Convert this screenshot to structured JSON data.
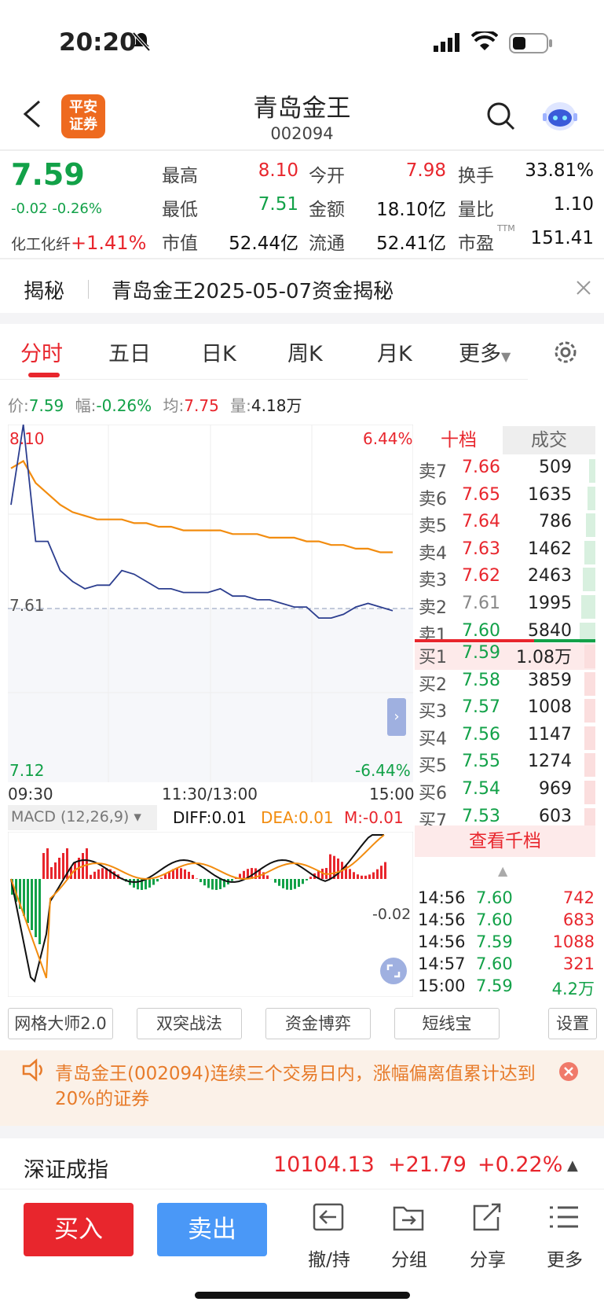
{
  "status": {
    "time": "20:20"
  },
  "header": {
    "back_icon": "chevron-left-icon",
    "logo_line1": "平安",
    "logo_line2": "证券",
    "title": "青岛金王",
    "code": "002094",
    "search_icon": "search-icon",
    "assistant_icon": "robot-icon"
  },
  "quote": {
    "price": "7.59",
    "change": "-0.02",
    "change_pct": "-0.26%",
    "sector_name": "化工化纤",
    "sector_pct": "+1.41%",
    "rows": [
      [
        {
          "label": "最高",
          "value": "8.10",
          "color": "red"
        },
        {
          "label": "今开",
          "value": "7.98",
          "color": "red"
        },
        {
          "label": "换手",
          "value": "33.81%",
          "color": "dark"
        }
      ],
      [
        {
          "label": "最低",
          "value": "7.51",
          "color": "green"
        },
        {
          "label": "金额",
          "value": "18.10亿",
          "color": "dark"
        },
        {
          "label": "量比",
          "value": "1.10",
          "color": "dark"
        }
      ],
      [
        {
          "label": "市值",
          "value": "52.44亿",
          "color": "dark"
        },
        {
          "label": "流通",
          "value": "52.41亿",
          "color": "dark"
        },
        {
          "label": "市盈",
          "value": "151.41",
          "color": "dark",
          "sup": "TTM"
        }
      ]
    ]
  },
  "reveal": {
    "tag": "揭秘",
    "text": "青岛金王2025-05-07资金揭秘"
  },
  "tabs": [
    "分时",
    "五日",
    "日K",
    "周K",
    "月K",
    "更多"
  ],
  "info": {
    "price_label": "价:",
    "price": "7.59",
    "amp_label": "幅:",
    "amp": "-0.26%",
    "avg_label": "均:",
    "avg": "7.75",
    "vol_label": "量:",
    "vol": "4.18万"
  },
  "chart_labels": {
    "top_price": "8.10",
    "top_pct": "6.44%",
    "mid_price": "7.61",
    "bottom_price": "7.12",
    "bottom_pct": "-6.44%",
    "time_start": "09:30",
    "time_mid": "11:30/13:00",
    "time_end": "15:00"
  },
  "chart_data": {
    "type": "line",
    "ylim": [
      7.12,
      8.1
    ],
    "series": [
      {
        "values": [
          7.88,
          8.1,
          7.78,
          7.78,
          7.7,
          7.67,
          7.65,
          7.66,
          7.66,
          7.7,
          7.69,
          7.67,
          7.65,
          7.65,
          7.64,
          7.64,
          7.64,
          7.65,
          7.63,
          7.63,
          7.62,
          7.62,
          7.61,
          7.6,
          7.6,
          7.57,
          7.57,
          7.58,
          7.6,
          7.61,
          7.6,
          7.59
        ]
      },
      {
        "values": [
          7.98,
          8.0,
          7.94,
          7.91,
          7.88,
          7.86,
          7.85,
          7.84,
          7.84,
          7.84,
          7.83,
          7.83,
          7.82,
          7.82,
          7.81,
          7.81,
          7.81,
          7.81,
          7.8,
          7.8,
          7.8,
          7.79,
          7.79,
          7.79,
          7.78,
          7.78,
          7.77,
          7.77,
          7.76,
          7.76,
          7.75,
          7.75
        ]
      }
    ]
  },
  "macd": {
    "label": "MACD (12,26,9)",
    "diff": "DIFF:0.01",
    "dea": "DEA:0.01",
    "m": "M:-0.01",
    "axis_value": "-0.02"
  },
  "orderbook": {
    "tab_active": "十档",
    "tab_other": "成交",
    "sell": [
      {
        "label": "卖7",
        "price": "7.66",
        "vol": "509",
        "pc": "red"
      },
      {
        "label": "卖6",
        "price": "7.65",
        "vol": "1635",
        "pc": "red"
      },
      {
        "label": "卖5",
        "price": "7.64",
        "vol": "786",
        "pc": "red"
      },
      {
        "label": "卖4",
        "price": "7.63",
        "vol": "1462",
        "pc": "red"
      },
      {
        "label": "卖3",
        "price": "7.62",
        "vol": "2463",
        "pc": "red"
      },
      {
        "label": "卖2",
        "price": "7.61",
        "vol": "1995",
        "pc": "gray"
      },
      {
        "label": "卖1",
        "price": "7.60",
        "vol": "5840",
        "pc": "green"
      }
    ],
    "buy": [
      {
        "label": "买1",
        "price": "7.59",
        "vol": "1.08万",
        "pc": "green"
      },
      {
        "label": "买2",
        "price": "7.58",
        "vol": "3859",
        "pc": "green"
      },
      {
        "label": "买3",
        "price": "7.57",
        "vol": "1008",
        "pc": "green"
      },
      {
        "label": "买4",
        "price": "7.56",
        "vol": "1147",
        "pc": "green"
      },
      {
        "label": "买5",
        "price": "7.55",
        "vol": "1274",
        "pc": "green"
      },
      {
        "label": "买6",
        "price": "7.54",
        "vol": "969",
        "pc": "green"
      },
      {
        "label": "买7",
        "price": "7.53",
        "vol": "603",
        "pc": "green"
      }
    ],
    "more_button": "查看千档"
  },
  "trades": [
    {
      "time": "14:56",
      "price": "7.60",
      "vol": "742"
    },
    {
      "time": "14:56",
      "price": "7.60",
      "vol": "683"
    },
    {
      "time": "14:56",
      "price": "7.59",
      "vol": "1088"
    },
    {
      "time": "14:57",
      "price": "7.60",
      "vol": "321"
    },
    {
      "time": "15:00",
      "price": "7.59",
      "vol": "4.2万"
    }
  ],
  "tools": [
    "网格大师2.0",
    "双突战法",
    "资金博弈",
    "短线宝",
    "设置"
  ],
  "notice": {
    "text": "青岛金王(002094)连续三个交易日内，涨幅偏离值累计达到20%的证券"
  },
  "index": {
    "name": "深证成指",
    "value": "10104.13",
    "change": "+21.79",
    "pct": "+0.22%"
  },
  "bottom": {
    "buy": "买入",
    "sell": "卖出",
    "actions": [
      "撤/持",
      "分组",
      "分享",
      "更多"
    ]
  },
  "colors": {
    "red": "#e8262d",
    "green": "#12a148",
    "buy_button": "#e8262d",
    "sell_button": "#4a98f7",
    "avg_line": "#f28c0f",
    "price_line": "#2c3e8f"
  }
}
